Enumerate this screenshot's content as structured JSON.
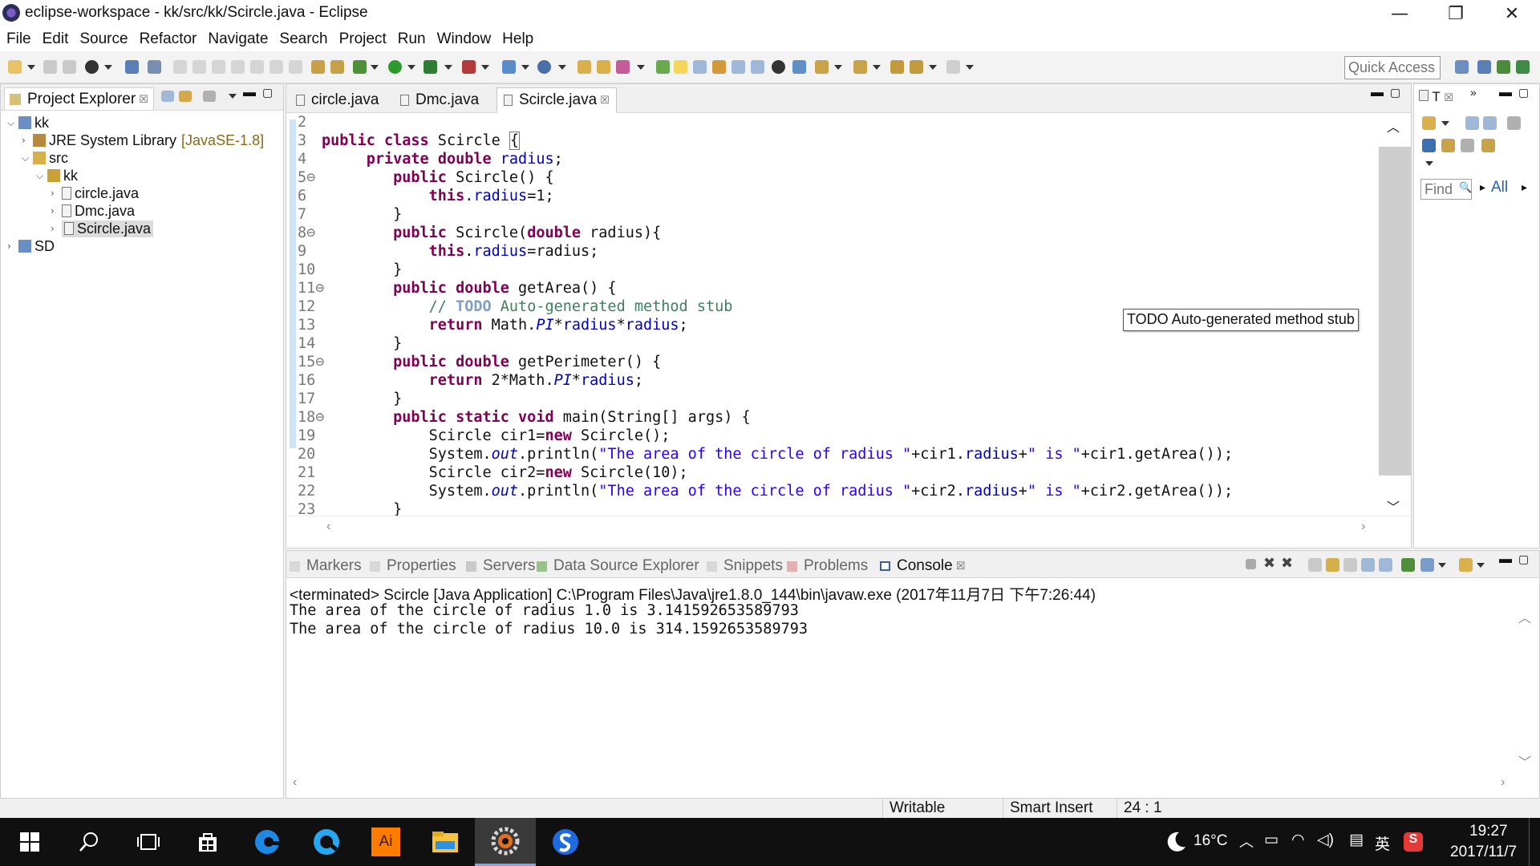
{
  "window": {
    "title": "eclipse-workspace - kk/src/kk/Scircle.java - Eclipse",
    "minimize_glyph": "—",
    "maximize_glyph": "❐",
    "close_glyph": "✕"
  },
  "menu": [
    "File",
    "Edit",
    "Source",
    "Refactor",
    "Navigate",
    "Search",
    "Project",
    "Run",
    "Window",
    "Help"
  ],
  "toolbar": {
    "quick_access": "Quick Access"
  },
  "project_explorer": {
    "title": "Project Explorer",
    "close_glyph": "☒",
    "tree": [
      {
        "label": "kk",
        "twisty": "⌵",
        "icon": "project-icon"
      },
      {
        "label": "JRE System Library",
        "suffix": "[JavaSE-1.8]",
        "twisty": "›",
        "icon": "library-icon"
      },
      {
        "label": "src",
        "twisty": "⌵",
        "icon": "source-folder-icon"
      },
      {
        "label": "kk",
        "twisty": "⌵",
        "icon": "package-icon"
      },
      {
        "label": "circle.java",
        "twisty": "›",
        "icon": "java-file-icon"
      },
      {
        "label": "Dmc.java",
        "twisty": "›",
        "icon": "java-file-icon"
      },
      {
        "label": "Scircle.java",
        "twisty": "›",
        "icon": "java-file-icon",
        "selected": true
      },
      {
        "label": "SD",
        "twisty": "›",
        "icon": "project-icon"
      }
    ]
  },
  "editor": {
    "tabs": [
      {
        "label": "circle.java",
        "active": false
      },
      {
        "label": "Dmc.java",
        "active": false
      },
      {
        "label": "Scircle.java",
        "active": true,
        "close_glyph": "☒"
      }
    ],
    "tooltip": "TODO Auto-generated method stub"
  },
  "outline": {
    "tab_label": "T",
    "find_placeholder": "Find",
    "find_glyph": "🔍",
    "all_label": "All"
  },
  "console": {
    "tabs": [
      {
        "label": "Markers",
        "active": false
      },
      {
        "label": "Properties",
        "active": false
      },
      {
        "label": "Servers",
        "active": false
      },
      {
        "label": "Data Source Explorer",
        "active": false
      },
      {
        "label": "Snippets",
        "active": false
      },
      {
        "label": "Problems",
        "active": false
      },
      {
        "label": "Console",
        "active": true,
        "close_glyph": "☒"
      }
    ],
    "status": "<terminated> Scircle [Java Application] C:\\Program Files\\Java\\jre1.8.0_144\\bin\\javaw.exe (2017年11月7日 下午7:26:44)",
    "output": [
      "The area of the circle of radius 1.0 is 3.141592653589793",
      "The area of the circle of radius 10.0 is 314.1592653589793"
    ]
  },
  "statusbar": {
    "writable": "Writable",
    "insert_mode": "Smart Insert",
    "position": "24 : 1"
  },
  "taskbar": {
    "temperature": "16°C",
    "ime": "英",
    "time": "19:27",
    "date": "2017/11/7",
    "ai_label": "Ai"
  },
  "colors": {
    "keyword": "#7f0055",
    "field": "#0000c0",
    "string": "#2a00ff",
    "comment": "#3f7f5f",
    "taskbar": "#101010"
  }
}
